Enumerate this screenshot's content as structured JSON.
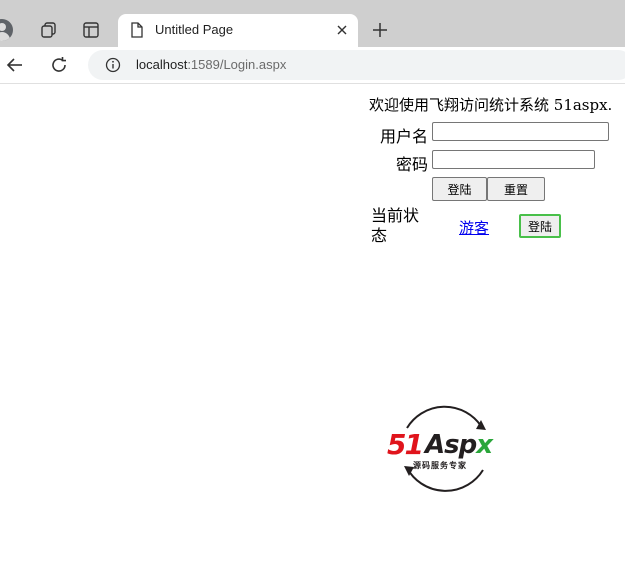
{
  "browser": {
    "tab": {
      "title": "Untitled Page"
    },
    "address": {
      "host": "localhost",
      "rest": ":1589/Login.aspx"
    }
  },
  "page": {
    "welcome_text": "欢迎使用飞翔访问统计系统 51aspx.",
    "form": {
      "username_label": "用户名",
      "username_value": "",
      "password_label": "密码",
      "password_value": "",
      "login_button": "登陆",
      "reset_button": "重置"
    },
    "status": {
      "label": "当前状态",
      "value": "游客",
      "login_button": "登陆"
    },
    "logo": {
      "brand_digits": "51",
      "brand_text": "Aspx",
      "tagline": "源码服务专家",
      "colors": {
        "red": "#e0141c",
        "dark": "#231f20",
        "green": "#2aa63a"
      }
    }
  }
}
